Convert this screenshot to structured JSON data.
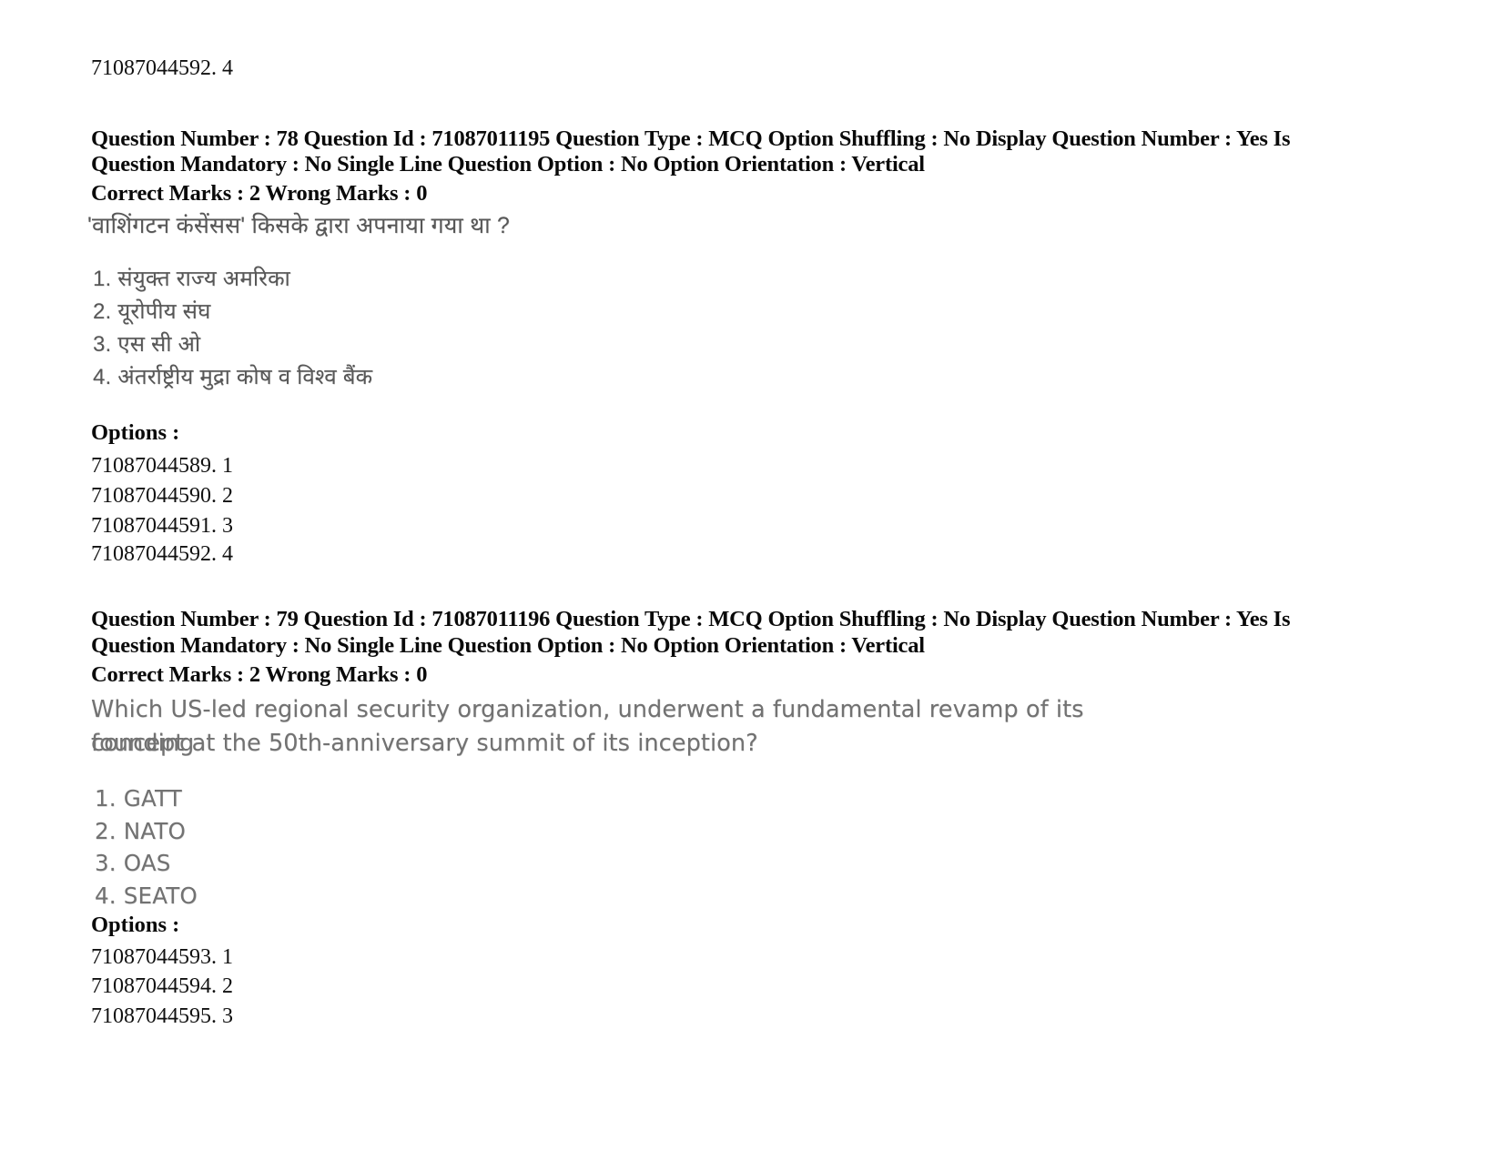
{
  "page": {
    "background_color": "#ffffff",
    "text_color": "#000000",
    "scan_text_color": "#5e5e5e"
  },
  "top_carryover": {
    "option_id_line": "71087044592. 4"
  },
  "questions": [
    {
      "header_line_1": "Question Number : 78 Question Id : 71087011195 Question Type : MCQ Option Shuffling : No Display Question Number : Yes Is",
      "header_line_2": "Question Mandatory : No Single Line Question Option : No Option Orientation : Vertical",
      "marks_line": "Correct Marks : 2 Wrong Marks : 0",
      "question_text_lines": [
        "'वाशिंगटन कंसेंसस' किसके द्वारा अपनाया गया था ?"
      ],
      "choices": [
        "1. संयुक्त राज्य अमरिका",
        "2. यूरोपीय संघ",
        "3. एस सी ओ",
        "4. अंतर्राष्ट्रीय मुद्रा कोष व विश्व बैंक"
      ],
      "options_label": "Options :",
      "option_ids": [
        "71087044589. 1",
        "71087044590. 2",
        "71087044591. 3",
        "71087044592. 4"
      ]
    },
    {
      "header_line_1": "Question Number : 79 Question Id : 71087011196 Question Type : MCQ Option Shuffling : No Display Question Number : Yes Is",
      "header_line_2": "Question Mandatory : No Single Line Question Option : No Option Orientation : Vertical",
      "marks_line": "Correct Marks : 2 Wrong Marks : 0",
      "question_text_lines": [
        "Which US-led regional security organization, underwent a fundamental revamp of its founding",
        "concept at the 50th-anniversary summit of its inception?"
      ],
      "choices": [
        "1. GATT",
        "2. NATO",
        "3. OAS",
        "4. SEATO"
      ],
      "options_label": "Options :",
      "option_ids": [
        "71087044593. 1",
        "71087044594. 2",
        "71087044595. 3"
      ]
    }
  ]
}
